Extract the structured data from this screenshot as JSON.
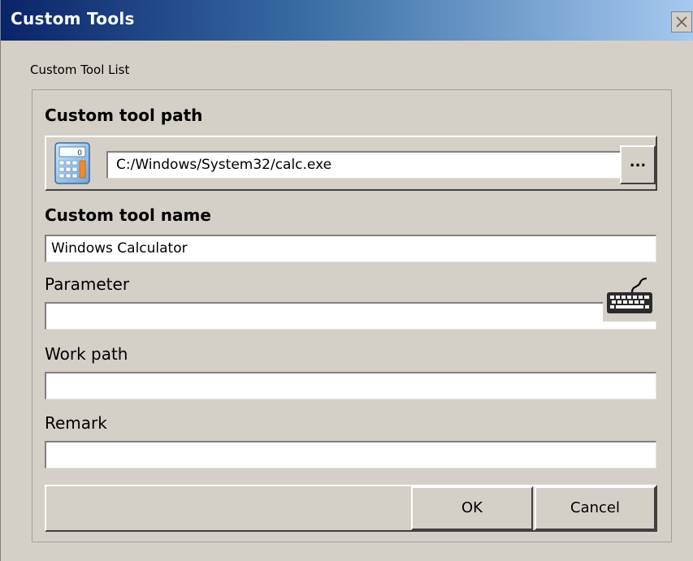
{
  "window": {
    "title": "Custom Tools",
    "close_label": "×"
  },
  "list_label": "Custom Tool List",
  "path_section": {
    "heading": "Custom tool path",
    "value": "C:/Windows/System32/calc.exe",
    "browse_label": "...",
    "icon": "calculator-icon"
  },
  "name_section": {
    "heading": "Custom tool name",
    "value": "Windows Calculator"
  },
  "parameter": {
    "label": "Parameter",
    "value": "",
    "icon": "keyboard-icon"
  },
  "work_path": {
    "label": "Work path",
    "value": ""
  },
  "remark": {
    "label": "Remark",
    "value": ""
  },
  "buttons": {
    "ok": "OK",
    "cancel": "Cancel"
  },
  "colors": {
    "titlebar_start": "#0a246a",
    "titlebar_end": "#a6caf0",
    "face": "#d4d0c8"
  }
}
